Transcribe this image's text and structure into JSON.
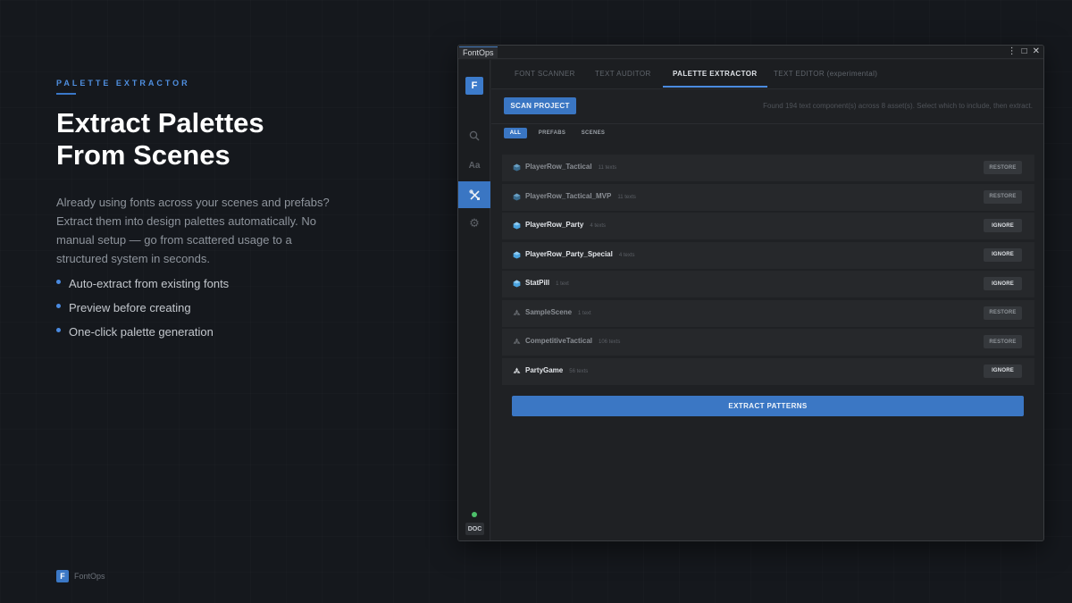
{
  "left": {
    "eyebrow": "PALETTE EXTRACTOR",
    "headline_line1": "Extract Palettes",
    "headline_line2": "From Scenes",
    "description": "Already using fonts across your scenes and prefabs? Extract them into design palettes automatically. No manual setup — go from scattered usage to a structured system in seconds.",
    "bullets": [
      "Auto-extract from existing fonts",
      "Preview before creating",
      "One-click palette generation"
    ]
  },
  "footer": {
    "logo_letter": "F",
    "brand": "FontOps"
  },
  "window": {
    "title": "FontOps",
    "controls": {
      "menu": "⋮",
      "maximize": "□",
      "close": "✕"
    },
    "sidebar": {
      "logo_letter": "F",
      "items": [
        {
          "icon": "search-icon",
          "glyph": "⚲",
          "active": false
        },
        {
          "icon": "font-icon",
          "glyph": "Aa",
          "active": false
        },
        {
          "icon": "tools-icon",
          "glyph": "✕",
          "active": true
        },
        {
          "icon": "gear-icon",
          "glyph": "⚙",
          "active": false
        }
      ],
      "status_color": "#4dc06a",
      "doc_label": "DOC"
    },
    "tabs": [
      "FONT SCANNER",
      "TEXT AUDITOR",
      "PALETTE EXTRACTOR",
      "TEXT EDITOR (experimental)"
    ],
    "active_tab": "PALETTE EXTRACTOR",
    "toolbar": {
      "scan_label": "SCAN PROJECT",
      "found_text": "Found 194 text component(s) across 8 asset(s). Select which to include, then extract."
    },
    "filters": [
      "ALL",
      "PREFABS",
      "SCENES"
    ],
    "active_filter": "ALL",
    "assets": [
      {
        "type": "prefab",
        "name": "PlayerRow_Tactical",
        "count": "11 texts",
        "action": "RESTORE",
        "included": false
      },
      {
        "type": "prefab",
        "name": "PlayerRow_Tactical_MVP",
        "count": "11 texts",
        "action": "RESTORE",
        "included": false
      },
      {
        "type": "prefab",
        "name": "PlayerRow_Party",
        "count": "4 texts",
        "action": "IGNORE",
        "included": true
      },
      {
        "type": "prefab",
        "name": "PlayerRow_Party_Special",
        "count": "4 texts",
        "action": "IGNORE",
        "included": true
      },
      {
        "type": "prefab",
        "name": "StatPill",
        "count": "1 text",
        "action": "IGNORE",
        "included": true
      },
      {
        "type": "scene",
        "name": "SampleScene",
        "count": "1 text",
        "action": "RESTORE",
        "included": false
      },
      {
        "type": "scene",
        "name": "CompetitiveTactical",
        "count": "106 texts",
        "action": "RESTORE",
        "included": false
      },
      {
        "type": "scene",
        "name": "PartyGame",
        "count": "56 texts",
        "action": "IGNORE",
        "included": true
      }
    ],
    "extract_label": "EXTRACT PATTERNS",
    "colors": {
      "accent": "#3a76c3",
      "prefab_icon": "#4aa3df",
      "scene_icon": "#9aa0a7"
    }
  }
}
